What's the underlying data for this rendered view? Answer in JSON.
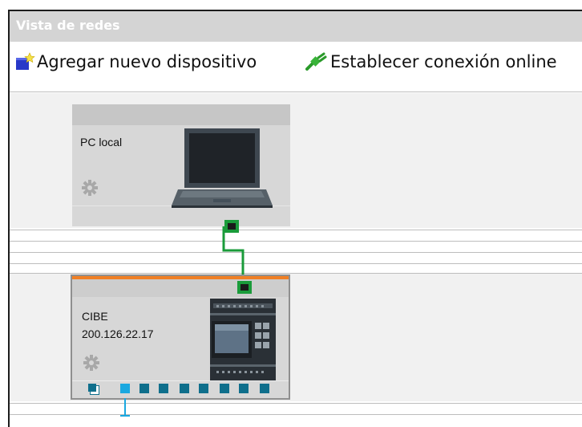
{
  "window": {
    "title": "Vista de redes"
  },
  "toolbar": {
    "add_device_label": "Agregar nuevo dispositivo",
    "go_online_label": "Establecer conexión online"
  },
  "devices": {
    "pc": {
      "name": "PC local"
    },
    "plc": {
      "name": "CIBE",
      "ip": "200.126.22.17"
    }
  },
  "colors": {
    "connection": "#1a9b3a",
    "plc_header_accent": "#f07f24",
    "io_port": "#0f6f8c",
    "selected_port": "#1aa8e0"
  },
  "icons": [
    "new-device-icon",
    "connection-plug-icon",
    "gear-icon",
    "laptop-icon",
    "plc-module-icon",
    "ethernet-port-icon"
  ]
}
